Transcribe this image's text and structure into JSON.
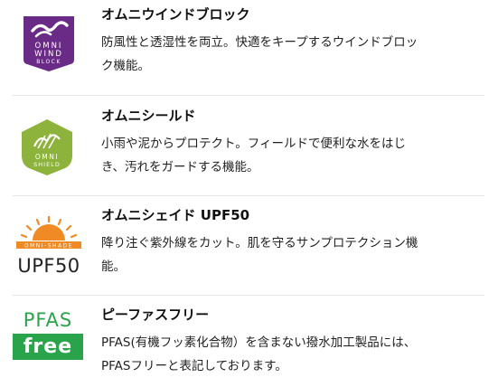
{
  "colors": {
    "wind": "#6a2b86",
    "shield": "#8db33d",
    "shade": "#f08a24",
    "pfas": "#2aa44a"
  },
  "features": [
    {
      "icon": "omni-wind-block-badge",
      "badge_lines": [
        "OMNI",
        "WIND",
        "BLOCK"
      ],
      "title": "オムニウインドブロック",
      "desc_lines": [
        "防風性と透湿性を両立。快適をキープするウインドブロッ",
        "ク機能。"
      ]
    },
    {
      "icon": "omni-shield-badge",
      "badge_lines": [
        "OMNI",
        "SHIELD"
      ],
      "title": "オムニシールド",
      "desc_lines": [
        "小雨や泥からプロテクト。フィールドで便利な水をはじ",
        "き、汚れをガードする機能。"
      ]
    },
    {
      "icon": "omni-shade-badge",
      "badge_lines": [
        "OMNI-SHADE",
        "UPF50"
      ],
      "title": "オムニシェイド UPF50",
      "desc_lines": [
        "降り注ぐ紫外線をカット。肌を守るサンプロテクション機",
        "能。"
      ]
    },
    {
      "icon": "pfas-free-badge",
      "badge_lines": [
        "PFAS",
        "free"
      ],
      "title": "ピーファスフリー",
      "desc_lines": [
        "PFAS(有機フッ素化合物）を含まない撥水加工製品には、",
        "PFASフリーと表記しております。"
      ]
    }
  ]
}
